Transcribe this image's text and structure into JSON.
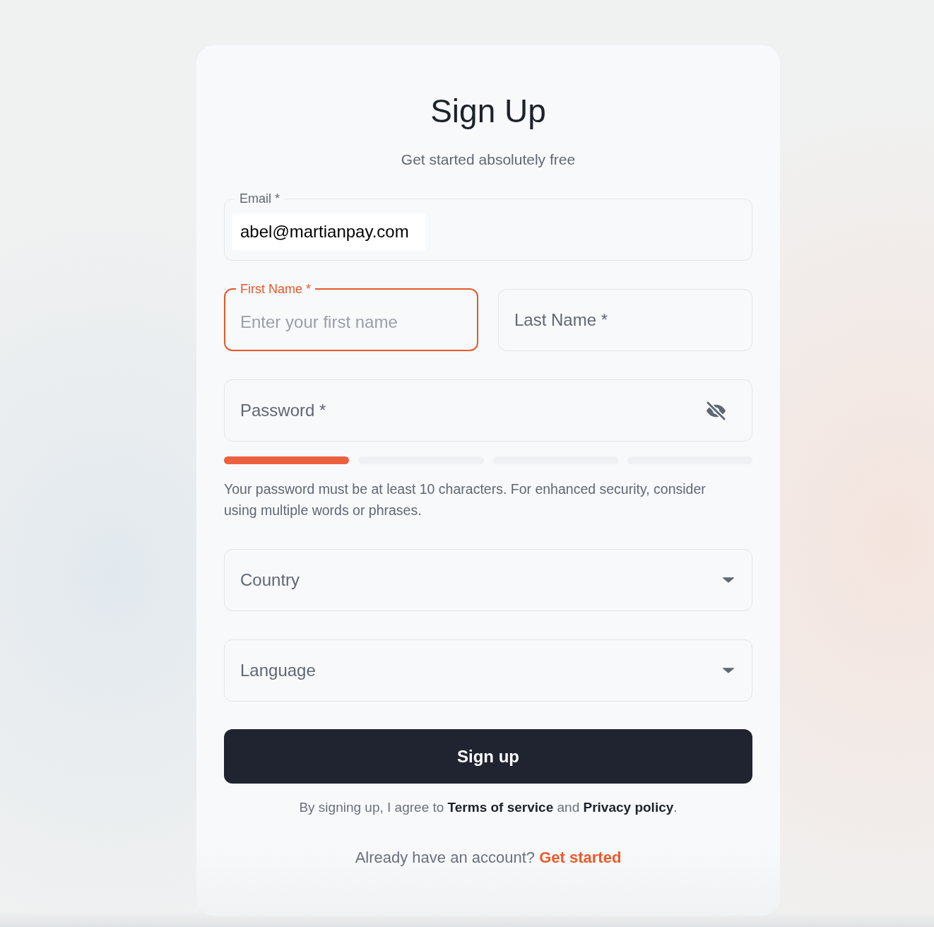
{
  "form": {
    "title": "Sign Up",
    "subtitle": "Get started absolutely free"
  },
  "fields": [
    {
      "kind": "input",
      "label": "Email *",
      "value": "abel@martianpay.com",
      "focused": false
    },
    {
      "kind": "pair",
      "fields": [
        {
          "kind": "input",
          "label": "First Name *",
          "placeholder": "Enter your first name",
          "focused": true
        },
        {
          "kind": "input",
          "label": "Last Name *",
          "focused": false
        }
      ]
    },
    {
      "kind": "password",
      "label": "Password *",
      "focused": false,
      "visible": false,
      "strength_segments": [
        {
          "filled": true
        },
        {
          "filled": false
        },
        {
          "filled": false
        },
        {
          "filled": false
        }
      ],
      "hint": "Your password must be at least 10 characters. For enhanced security, consider using multiple words or phrases."
    },
    {
      "kind": "select",
      "label": "Country"
    },
    {
      "kind": "select",
      "label": "Language"
    }
  ],
  "submit_button": {
    "label": "Sign up"
  },
  "terms": [
    {
      "kind": "text",
      "text": "By signing up, I agree to "
    },
    {
      "kind": "link",
      "text": "Terms of service"
    },
    {
      "kind": "text",
      "text": " and "
    },
    {
      "kind": "link",
      "text": "Privacy policy"
    },
    {
      "kind": "text",
      "text": "."
    }
  ],
  "signin_prompt": {
    "text": "Already have an account?",
    "link": "Get started"
  }
}
